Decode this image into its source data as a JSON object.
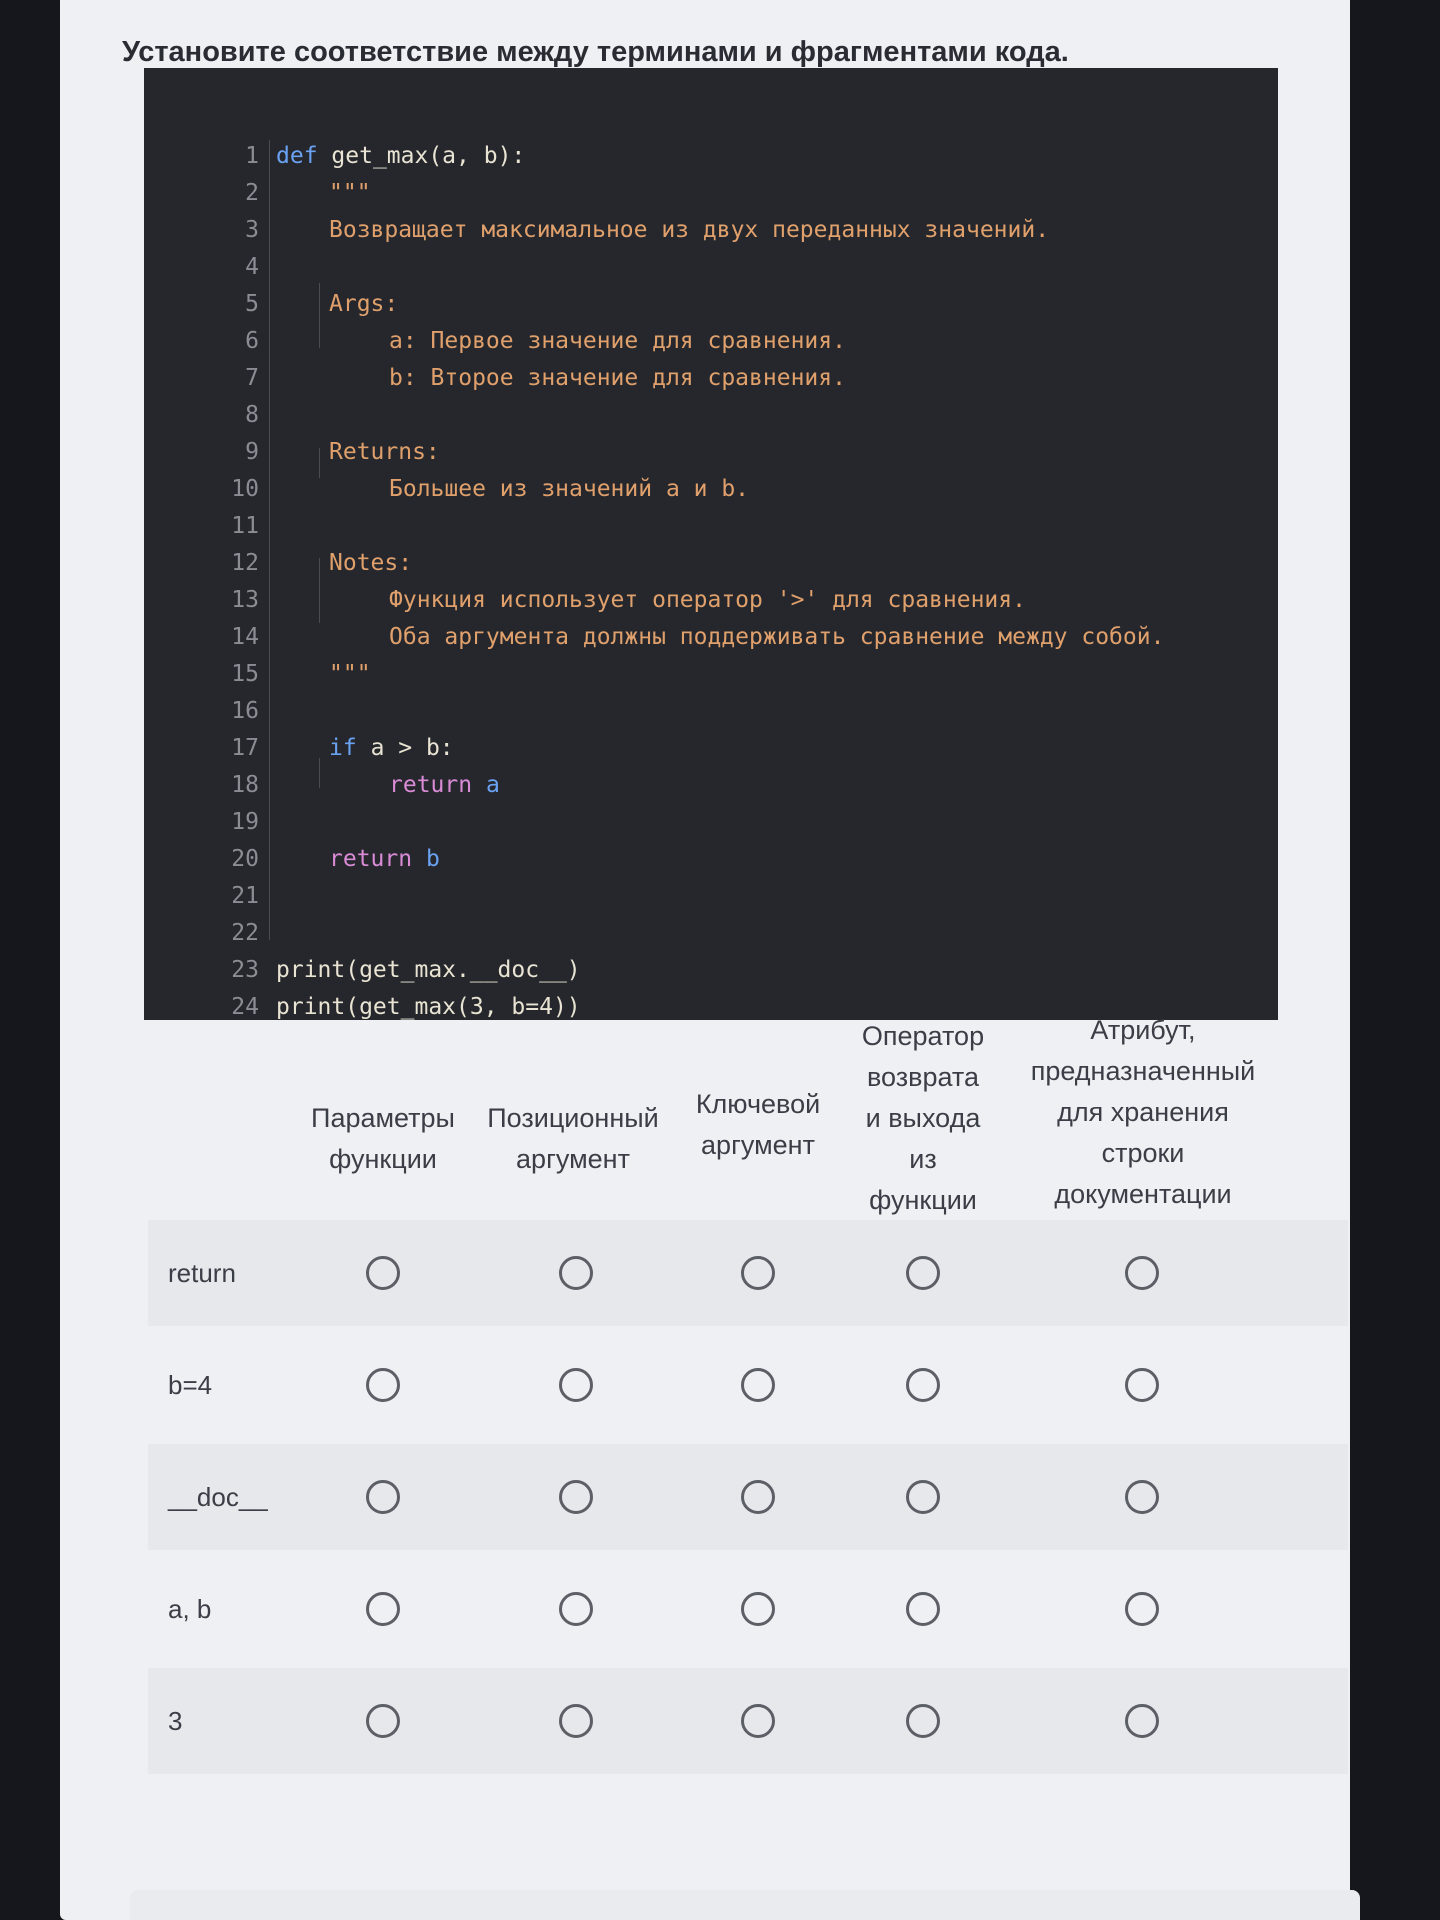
{
  "question": "Установите соответствие между терминами и фрагментами кода.",
  "code_lines": [
    {
      "n": "1"
    },
    {
      "n": "2"
    },
    {
      "n": "3"
    },
    {
      "n": "4"
    },
    {
      "n": "5"
    },
    {
      "n": "6"
    },
    {
      "n": "7"
    },
    {
      "n": "8"
    },
    {
      "n": "9"
    },
    {
      "n": "10"
    },
    {
      "n": "11"
    },
    {
      "n": "12"
    },
    {
      "n": "13"
    },
    {
      "n": "14"
    },
    {
      "n": "15"
    },
    {
      "n": "16"
    },
    {
      "n": "17"
    },
    {
      "n": "18"
    },
    {
      "n": "19"
    },
    {
      "n": "20"
    },
    {
      "n": "21"
    },
    {
      "n": "22"
    },
    {
      "n": "23"
    },
    {
      "n": "24"
    }
  ],
  "code": {
    "l1_kw": "def",
    "l1_rest": "get_max(a, b):",
    "l2": "\"\"\"",
    "l3": "Возвращает максимальное из двух переданных значений.",
    "l5": "Args:",
    "l6": "a: Первое значение для сравнения.",
    "l7": "b: Второе значение для сравнения.",
    "l9": "Returns:",
    "l10": "Большее из значений a и b.",
    "l12": "Notes:",
    "l13": "Функция использует оператор '>' для сравнения.",
    "l14": "Оба аргумента должны поддерживать сравнение между собой.",
    "l15": "\"\"\"",
    "l17_kw": "if",
    "l17_rest": "a > b:",
    "l18_kw": "return",
    "l18_rest": "a",
    "l20_kw": "return",
    "l20_rest": "b",
    "l23": "print(get_max.__doc__)",
    "l24": "print(get_max(3, b=4))"
  },
  "columns": [
    {
      "label_lines": [
        "Параметры",
        "функции"
      ]
    },
    {
      "label_lines": [
        "Позиционный",
        "аргумент"
      ]
    },
    {
      "label_lines": [
        "Ключевой",
        "аргумент"
      ]
    },
    {
      "label_lines": [
        "Оператор",
        "возврата",
        "и выхода",
        "из",
        "функции"
      ]
    },
    {
      "label_lines": [
        "Атрибут,",
        "предназначенный",
        "для хранения",
        "строки",
        "документации"
      ]
    }
  ],
  "rows": [
    {
      "label": "return"
    },
    {
      "label": "b=4"
    },
    {
      "label": "__doc__"
    },
    {
      "label": "a, b"
    },
    {
      "label": "3"
    }
  ],
  "colors": {
    "code_bg": "#25272c",
    "keyword": "#6aa2f2",
    "string": "#e0a06c",
    "page_bg": "#eef0f3"
  }
}
